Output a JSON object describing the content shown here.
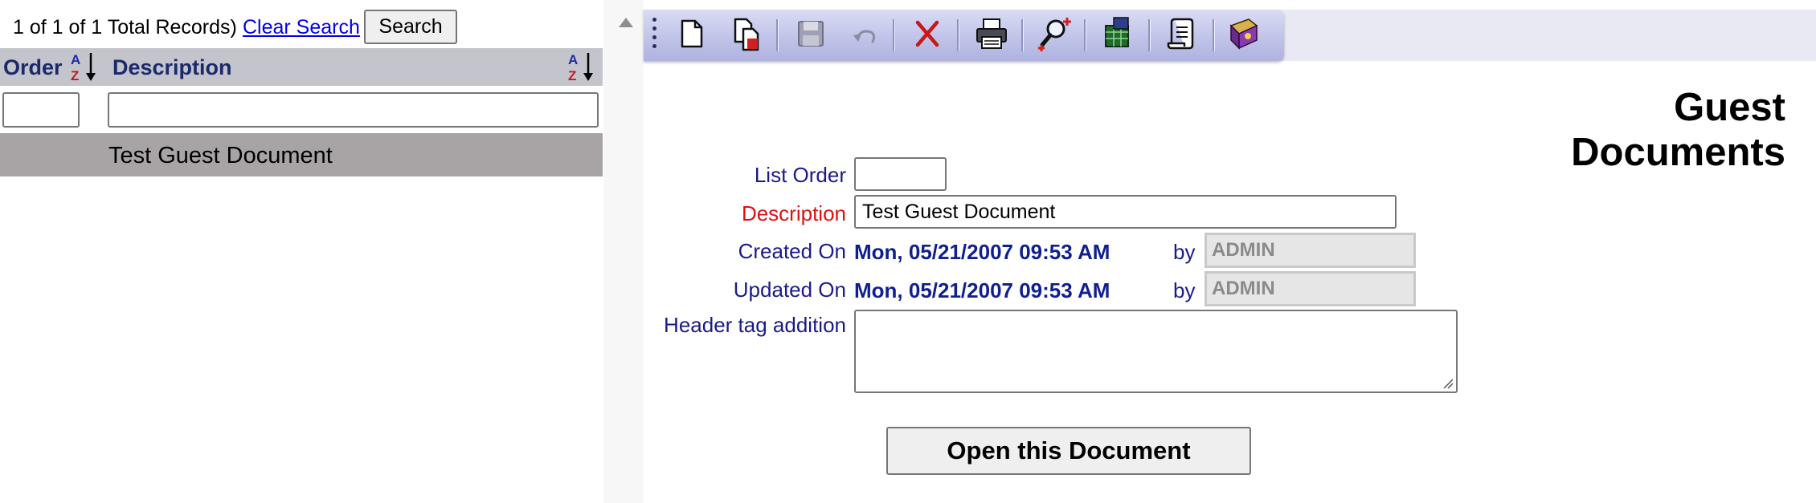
{
  "list": {
    "records_text": "1 of 1 of 1 Total Records)",
    "clear_search_label": "Clear Search",
    "search_label": "Search",
    "columns": {
      "order": "Order",
      "description": "Description"
    },
    "filter": {
      "order_value": "",
      "description_value": ""
    },
    "rows": [
      {
        "order": "",
        "description": "Test Guest Document"
      }
    ]
  },
  "toolbar": {
    "buttons": [
      {
        "icon": "new-document-icon",
        "enabled": true
      },
      {
        "icon": "copy-document-icon",
        "enabled": true
      },
      {
        "icon": "save-icon",
        "enabled": false
      },
      {
        "icon": "undo-icon",
        "enabled": false
      },
      {
        "icon": "delete-icon",
        "enabled": true
      },
      {
        "icon": "print-icon",
        "enabled": true
      },
      {
        "icon": "search-add-icon",
        "enabled": true
      },
      {
        "icon": "export-icon",
        "enabled": true
      },
      {
        "icon": "script-icon",
        "enabled": true
      },
      {
        "icon": "help-book-icon",
        "enabled": true
      }
    ]
  },
  "detail": {
    "title": "Guest Documents",
    "list_order_label": "List Order",
    "list_order_value": "",
    "description_label": "Description",
    "description_value": "Test Guest Document",
    "created_on_label": "Created On",
    "created_on_value": "Mon, 05/21/2007 09:53 AM",
    "created_by_label": "by",
    "created_by_value": "ADMIN",
    "updated_on_label": "Updated On",
    "updated_on_value": "Mon, 05/21/2007 09:53 AM",
    "updated_by_label": "by",
    "updated_by_value": "ADMIN",
    "header_tag_label": "Header tag addition",
    "header_tag_value": "",
    "open_button_label": "Open this Document"
  },
  "colors": {
    "label_blue": "#1a1a8c",
    "required_red": "#e01010",
    "value_blue": "#0f1f8f",
    "grid_header": "#c4c4cc",
    "selected_row": "#a8a4a6",
    "toolbar": "#c3c6ea"
  }
}
